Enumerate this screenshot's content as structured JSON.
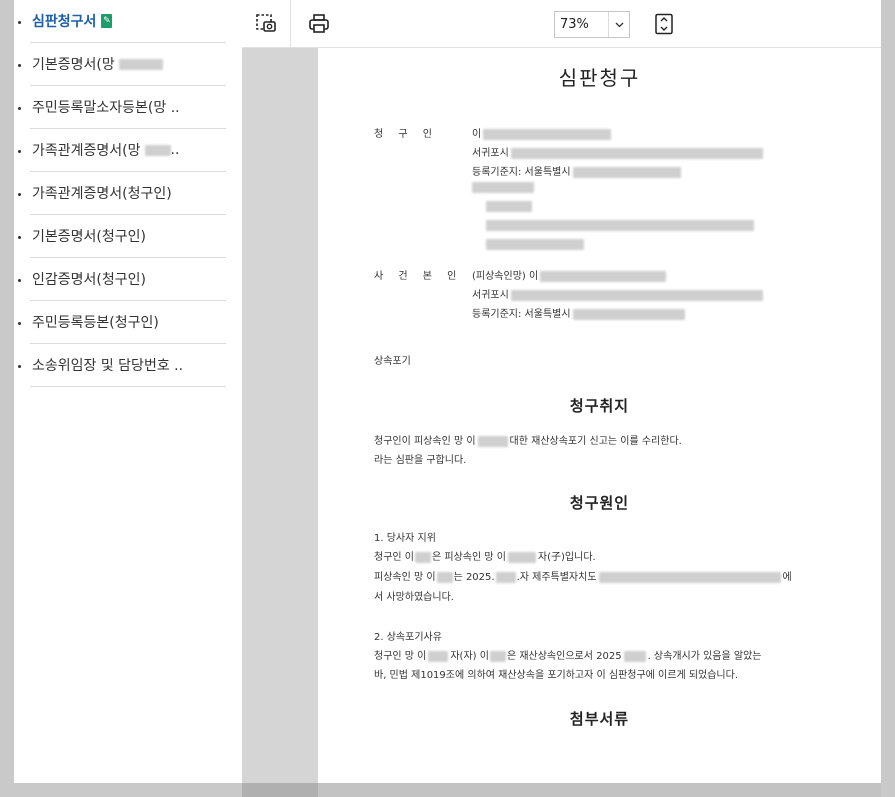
{
  "sidebar": {
    "items": [
      {
        "label": "심판청구서",
        "active": true
      },
      {
        "label": "기본증명서(망"
      },
      {
        "label": "주민등록말소자등본(망 .."
      },
      {
        "label": "가족관계증명서(망"
      },
      {
        "label": "가족관계증명서(청구인)"
      },
      {
        "label": "기본증명서(청구인)"
      },
      {
        "label": "인감증명서(청구인)"
      },
      {
        "label": "주민등록등본(청구인)"
      },
      {
        "label": "소송위임장 및 담당번호 .."
      }
    ],
    "ellipsis": ".."
  },
  "toolbar": {
    "zoom_value": "73%",
    "icons": [
      "screenshot-icon",
      "print-icon",
      "fit-page-icon"
    ]
  },
  "document": {
    "title": "심판청구",
    "claimant_label": "청 구 인",
    "claimant_name_prefix": "이",
    "claimant_addr_prefix": "서귀포시",
    "claimant_reg_prefix": "등록기준지: 서울특별시",
    "subject_label": "사 건 본 인",
    "subject_name_prefix": "(피상속인망) 이",
    "subject_addr_prefix": "서귀포시",
    "subject_reg_prefix": "등록기준지: 서울특별시",
    "case_type": "상속포기",
    "purpose_heading": "청구취지",
    "purpose_line1_a": "청구인이 피상속인 망 이",
    "purpose_line1_b": "대한 재산상속포기 신고는 이를 수리한다.",
    "purpose_line2": "라는 심판을 구합니다.",
    "cause_heading": "청구원인",
    "cause_1_title": "1. 당사자 지위",
    "cause_1_line1_a": "청구인 이",
    "cause_1_line1_b": "은 피상속인 망 이",
    "cause_1_line1_c": "자(子)입니다.",
    "cause_1_line2_a": "피상속인 망 이",
    "cause_1_line2_b": "는 2025.",
    "cause_1_line2_c": ".자 제주특별자치도",
    "cause_1_line2_d": "에",
    "cause_1_line3": "서 사망하였습니다.",
    "cause_2_title": "2. 상속포기사유",
    "cause_2_line1_a": "청구인 망 이",
    "cause_2_line1_b": "자(자) 이",
    "cause_2_line1_c": "은 재산상속인으로서 2025",
    "cause_2_line1_d": ". 상속개시가 있음을 알았는",
    "cause_2_line2": "바, 민법 제1019조에 의하여 재산상속을 포기하고자 이 심판청구에 이르게 되었습니다.",
    "attach_heading": "첨부서류"
  }
}
